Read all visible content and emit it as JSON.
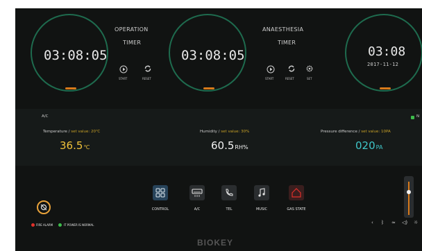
{
  "operation": {
    "time": "03:08:05",
    "title_line1": "OPERATION",
    "title_line2": "TIMER",
    "start": "START",
    "reset": "RESET"
  },
  "anaesthesia": {
    "time": "03:08:05",
    "title_line1": "ANAESTHESIA",
    "title_line2": "TIMER",
    "start": "START",
    "reset": "RESET",
    "set": "SET"
  },
  "clock": {
    "time": "03:08",
    "date": "2017-11-12"
  },
  "panel": {
    "section_label": "A/C",
    "status_badge": "N",
    "temperature": {
      "label": "Temperature / ",
      "set_label": "set value: 20℃",
      "value": "36.5",
      "unit": "℃"
    },
    "humidity": {
      "label": "Humidity / ",
      "set_label": "set value: 30%",
      "value": "60.5",
      "unit": "RH%"
    },
    "pressure": {
      "label": "Pressure difference / ",
      "set_label": "set value: 10PA",
      "value": "020",
      "unit": "PA"
    }
  },
  "dock": [
    {
      "label": "CONTROL",
      "icon": "grid-icon"
    },
    {
      "label": "A/C",
      "icon": "air-conditioner-icon"
    },
    {
      "label": "TEL",
      "icon": "phone-icon"
    },
    {
      "label": "MUSIC",
      "icon": "music-note-icon"
    },
    {
      "label": "GAS STATE",
      "icon": "house-alarm-icon"
    }
  ],
  "status": {
    "fire_alarm": "FIRE ALARM",
    "power": "IT POWER IS NORMAL"
  },
  "colors": {
    "accent_green": "#1e6b4e",
    "accent_orange": "#d87a1a",
    "set_value": "#c9a227",
    "temp_value": "#f0c23a",
    "pressure_value": "#3fc6c8",
    "alarm_red": "#e0302a",
    "ok_green": "#3dbb4b"
  },
  "brand": "BIOKEY"
}
